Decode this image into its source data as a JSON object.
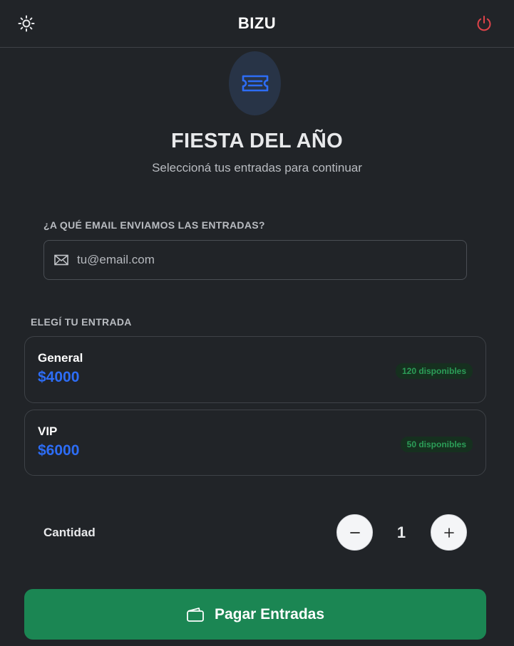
{
  "header": {
    "brand": "BIZU",
    "theme_icon": "sun-icon",
    "power_icon": "power-icon"
  },
  "event": {
    "title": "FIESTA DEL AÑO",
    "subtitle": "Seleccioná tus entradas para continuar",
    "badge_icon": "ticket-icon"
  },
  "email": {
    "label": "¿A QUÉ EMAIL ENVIAMOS LAS ENTRADAS?",
    "placeholder": "tu@email.com",
    "value": "",
    "icon": "mail-icon"
  },
  "tickets": {
    "label": "ELEGÍ TU ENTRADA",
    "items": [
      {
        "name": "General",
        "price": "$4000",
        "availability": "120 disponibles"
      },
      {
        "name": "VIP",
        "price": "$6000",
        "availability": "50 disponibles"
      }
    ]
  },
  "quantity": {
    "label": "Cantidad",
    "value": "1",
    "minus_icon": "minus-icon",
    "plus_icon": "plus-icon"
  },
  "pay": {
    "label": "Pagar Entradas",
    "icon": "wallet-icon"
  },
  "colors": {
    "background": "#212428",
    "accent_price": "#2d6df6",
    "pay_button": "#1b8653",
    "power_icon": "#e0434a",
    "availability_text": "#2c9e58"
  }
}
